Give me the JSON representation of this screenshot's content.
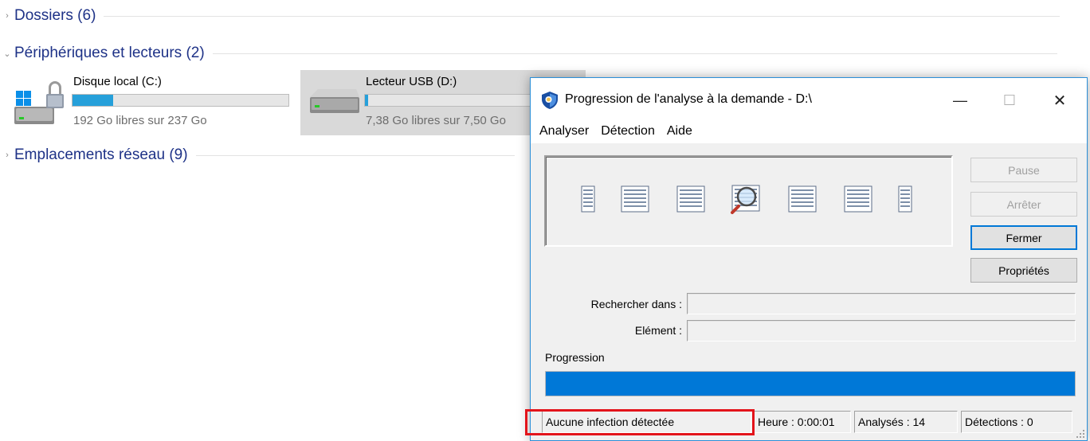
{
  "explorer": {
    "groups": [
      {
        "title": "Dossiers (6)"
      },
      {
        "title": "Périphériques et lecteurs (2)"
      },
      {
        "title": "Emplacements réseau (9)"
      }
    ],
    "drives": [
      {
        "name": "Disque local (C:)",
        "free_text": "192 Go libres sur 237 Go",
        "used_fraction": 0.19,
        "icon": "windows-drive-icon"
      },
      {
        "name": "Lecteur USB (D:)",
        "free_text": "7,38 Go libres sur 7,50 Go",
        "used_fraction": 0.016,
        "icon": "usb-drive-icon"
      }
    ]
  },
  "dialog": {
    "title": "Progression de l'analyse à la demande - D:\\",
    "window_controls": {
      "minimize": "—",
      "maximize": "☐",
      "close": "✕"
    },
    "menu": [
      "Analyser",
      "Détection",
      "Aide"
    ],
    "buttons": {
      "pause": "Pause",
      "stop": "Arrêter",
      "close": "Fermer",
      "properties": "Propriétés"
    },
    "fields": {
      "search_in_label": "Rechercher dans :",
      "search_in_value": "",
      "element_label": "Elément :",
      "element_value": ""
    },
    "progress": {
      "label": "Progression",
      "fraction": 1.0
    },
    "status": {
      "message": "Aucune infection détectée",
      "time": "Heure : 0:00:01",
      "analyzed": "Analysés : 14",
      "detections": "Détections : 0"
    },
    "colors": {
      "accent": "#0078d7",
      "highlight": "#e3141b",
      "explorer_title": "#1e3287",
      "drive_bar": "#26a0da"
    }
  }
}
